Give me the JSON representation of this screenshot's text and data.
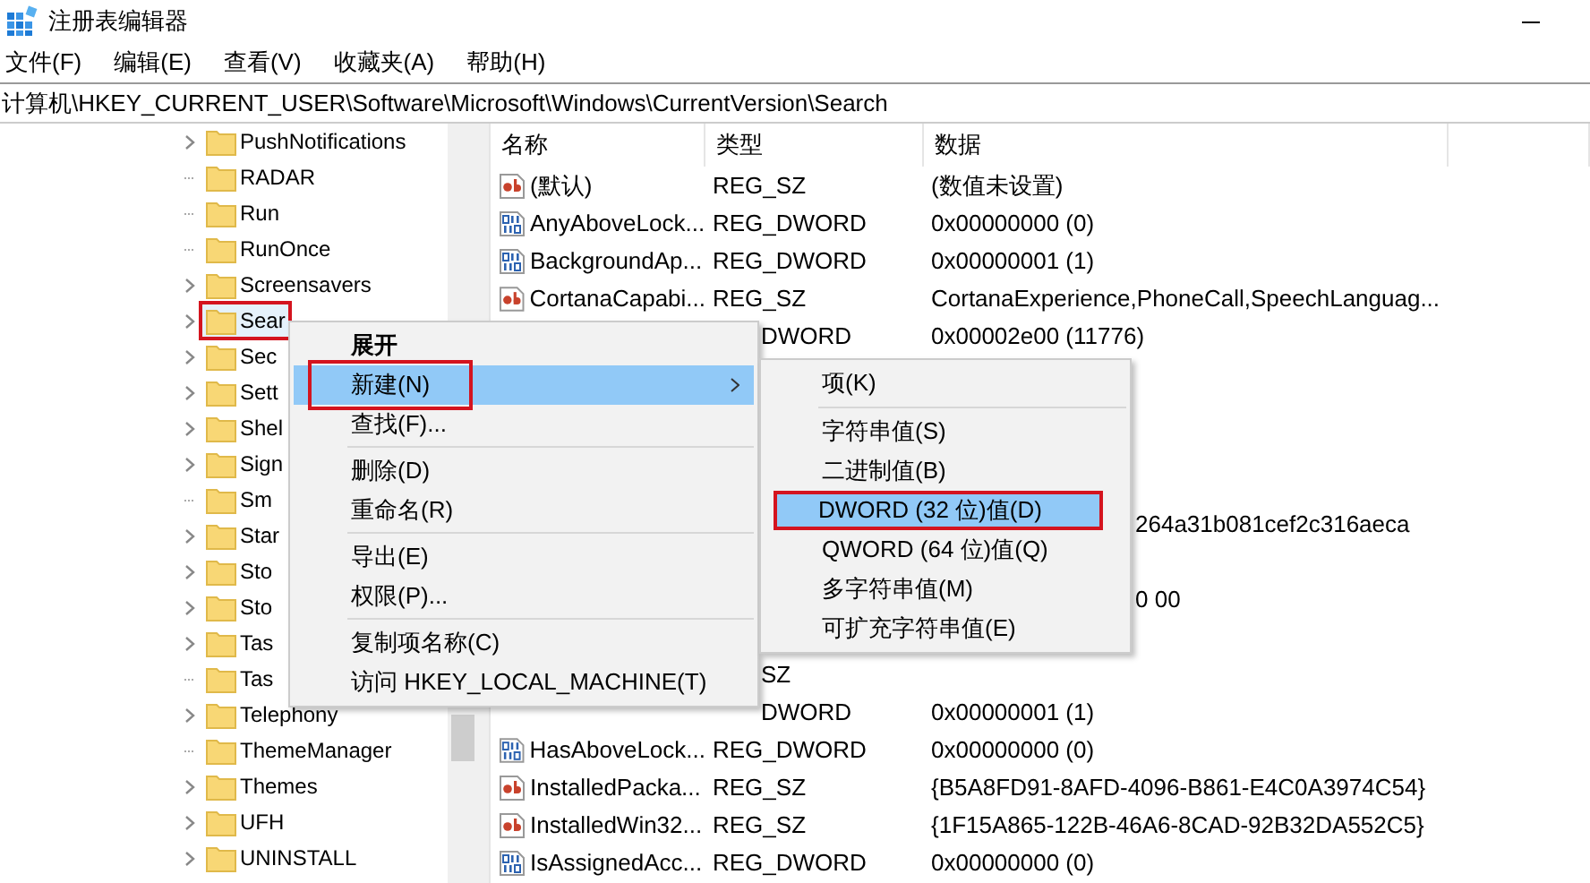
{
  "window": {
    "title": "注册表编辑器"
  },
  "menu_bar": [
    "文件(F)",
    "编辑(E)",
    "查看(V)",
    "收藏夹(A)",
    "帮助(H)"
  ],
  "address": "计算机\\HKEY_CURRENT_USER\\Software\\Microsoft\\Windows\\CurrentVersion\\Search",
  "tree": [
    {
      "label": "PushNotifications",
      "expandable": true,
      "selected": false,
      "marked": false
    },
    {
      "label": "RADAR",
      "expandable": false,
      "selected": false,
      "marked": false
    },
    {
      "label": "Run",
      "expandable": false,
      "selected": false,
      "marked": false
    },
    {
      "label": "RunOnce",
      "expandable": false,
      "selected": false,
      "marked": false
    },
    {
      "label": "Screensavers",
      "expandable": true,
      "selected": false,
      "marked": false
    },
    {
      "label": "Sear",
      "expandable": true,
      "selected": true,
      "marked": true
    },
    {
      "label": "Sec",
      "expandable": true,
      "selected": false,
      "marked": false
    },
    {
      "label": "Sett",
      "expandable": true,
      "selected": false,
      "marked": false
    },
    {
      "label": "Shel",
      "expandable": true,
      "selected": false,
      "marked": false
    },
    {
      "label": "Sign",
      "expandable": true,
      "selected": false,
      "marked": false
    },
    {
      "label": "Sm",
      "expandable": false,
      "selected": false,
      "marked": false
    },
    {
      "label": "Star",
      "expandable": true,
      "selected": false,
      "marked": false
    },
    {
      "label": "Sto",
      "expandable": true,
      "selected": false,
      "marked": false
    },
    {
      "label": "Sto",
      "expandable": true,
      "selected": false,
      "marked": false
    },
    {
      "label": "Tas",
      "expandable": true,
      "selected": false,
      "marked": false
    },
    {
      "label": "Tas",
      "expandable": false,
      "selected": false,
      "marked": false
    },
    {
      "label": "Telephony",
      "expandable": true,
      "selected": false,
      "marked": false
    },
    {
      "label": "ThemeManager",
      "expandable": false,
      "selected": false,
      "marked": false
    },
    {
      "label": "Themes",
      "expandable": true,
      "selected": false,
      "marked": false
    },
    {
      "label": "UFH",
      "expandable": true,
      "selected": false,
      "marked": false
    },
    {
      "label": "UNINSTALL",
      "expandable": true,
      "selected": false,
      "marked": false
    }
  ],
  "values_table": {
    "columns": [
      "名称",
      "类型",
      "数据"
    ],
    "rows": [
      {
        "kind": "full",
        "binary": false,
        "name": "(默认)",
        "type": "REG_SZ",
        "data": "(数值未设置)"
      },
      {
        "kind": "full",
        "binary": true,
        "name": "AnyAboveLock...",
        "type": "REG_DWORD",
        "data": "0x00000000 (0)"
      },
      {
        "kind": "full",
        "binary": true,
        "name": "BackgroundAp...",
        "type": "REG_DWORD",
        "data": "0x00000001 (1)"
      },
      {
        "kind": "full",
        "binary": false,
        "name": "CortanaCapabi...",
        "type": "REG_SZ",
        "data": "CortanaExperience,PhoneCall,SpeechLanguag..."
      },
      {
        "kind": "type-cut",
        "type": "DWORD",
        "data": "0x00002e00 (11776)"
      },
      {
        "kind": "hidden"
      },
      {
        "kind": "hidden"
      },
      {
        "kind": "hidden"
      },
      {
        "kind": "hidden"
      },
      {
        "kind": "data-cut",
        "data": "264a31b081cef2c316aeca"
      },
      {
        "kind": "hidden"
      },
      {
        "kind": "data-cut",
        "data": "0 00"
      },
      {
        "kind": "hidden"
      },
      {
        "kind": "type-cut",
        "type": "SZ"
      },
      {
        "kind": "type-cut",
        "type": "DWORD",
        "data": "0x00000001 (1)"
      },
      {
        "kind": "full",
        "binary": true,
        "name": "HasAboveLock...",
        "type": "REG_DWORD",
        "data": "0x00000000 (0)"
      },
      {
        "kind": "full",
        "binary": false,
        "name": "InstalledPacka...",
        "type": "REG_SZ",
        "data": "{B5A8FD91-8AFD-4096-B861-E4C0A3974C54}"
      },
      {
        "kind": "full",
        "binary": false,
        "name": "InstalledWin32...",
        "type": "REG_SZ",
        "data": "{1F15A865-122B-46A6-8CAD-92B32DA552C5}"
      },
      {
        "kind": "full",
        "binary": true,
        "name": "IsAssignedAcc...",
        "type": "REG_DWORD",
        "data": "0x00000000 (0)"
      }
    ]
  },
  "context_menu": [
    {
      "kind": "item",
      "label": "展开",
      "default": true,
      "selected": false,
      "submenu": false,
      "marked": false
    },
    {
      "kind": "item",
      "label": "新建(N)",
      "default": false,
      "selected": true,
      "submenu": true,
      "marked": true
    },
    {
      "kind": "item",
      "label": "查找(F)...",
      "default": false,
      "selected": false,
      "submenu": false,
      "marked": false
    },
    {
      "kind": "separator"
    },
    {
      "kind": "item",
      "label": "删除(D)",
      "default": false,
      "selected": false,
      "submenu": false,
      "marked": false
    },
    {
      "kind": "item",
      "label": "重命名(R)",
      "default": false,
      "selected": false,
      "submenu": false,
      "marked": false
    },
    {
      "kind": "separator"
    },
    {
      "kind": "item",
      "label": "导出(E)",
      "default": false,
      "selected": false,
      "submenu": false,
      "marked": false
    },
    {
      "kind": "item",
      "label": "权限(P)...",
      "default": false,
      "selected": false,
      "submenu": false,
      "marked": false
    },
    {
      "kind": "separator"
    },
    {
      "kind": "item",
      "label": "复制项名称(C)",
      "default": false,
      "selected": false,
      "submenu": false,
      "marked": false
    },
    {
      "kind": "item",
      "label": "访问 HKEY_LOCAL_MACHINE(T)",
      "default": false,
      "selected": false,
      "submenu": false,
      "marked": false
    }
  ],
  "new_submenu": [
    {
      "kind": "item",
      "label": "项(K)",
      "selected": false,
      "marked": false
    },
    {
      "kind": "separator"
    },
    {
      "kind": "item",
      "label": "字符串值(S)",
      "selected": false,
      "marked": false
    },
    {
      "kind": "item",
      "label": "二进制值(B)",
      "selected": false,
      "marked": false
    },
    {
      "kind": "item",
      "label": "DWORD (32 位)值(D)",
      "selected": true,
      "marked": true
    },
    {
      "kind": "item",
      "label": "QWORD (64 位)值(Q)",
      "selected": false,
      "marked": false
    },
    {
      "kind": "item",
      "label": "多字符串值(M)",
      "selected": false,
      "marked": false
    },
    {
      "kind": "item",
      "label": "可扩充字符串值(E)",
      "selected": false,
      "marked": false
    }
  ]
}
